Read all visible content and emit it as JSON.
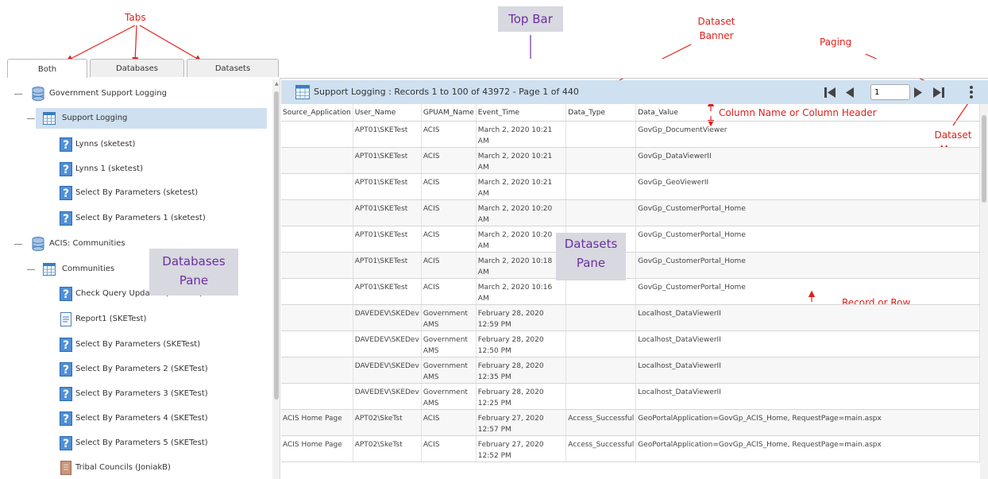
{
  "annotations": {
    "tabs": "Tabs",
    "top_bar": "Top Bar",
    "dataset_banner": "Dataset\nBanner",
    "paging": "Paging",
    "column_header": "Column Name or Column Header",
    "dataset_menu": "Dataset\nMenu",
    "record_row": "Record or Row",
    "databases_pane": "Databases\nPane",
    "datasets_pane": "Datasets\nPane"
  },
  "tabs": [
    "Both",
    "Databases",
    "Datasets"
  ],
  "tree": [
    {
      "label": "Government Support Logging",
      "icon": "database-icon"
    },
    {
      "label": "Support Logging",
      "icon": "table-icon"
    },
    {
      "label": "Lynns (sketest)",
      "icon": "query-icon"
    },
    {
      "label": "Lynns 1 (sketest)",
      "icon": "query-icon"
    },
    {
      "label": "Select By Parameters (sketest)",
      "icon": "query-icon"
    },
    {
      "label": "Select By Parameters 1 (sketest)",
      "icon": "query-icon"
    },
    {
      "label": "ACIS: Communities",
      "icon": "database-icon"
    },
    {
      "label": "Communities",
      "icon": "table-icon"
    },
    {
      "label": "Check Query Updated (SKETest)",
      "icon": "query-icon"
    },
    {
      "label": "Report1 (SKETest)",
      "icon": "report-icon"
    },
    {
      "label": "Select By Parameters (SKETest)",
      "icon": "query-icon"
    },
    {
      "label": "Select By Parameters 2 (SKETest)",
      "icon": "query-icon"
    },
    {
      "label": "Select By Parameters 3 (SKETest)",
      "icon": "query-icon"
    },
    {
      "label": "Select By Parameters 4 (SKETest)",
      "icon": "query-icon"
    },
    {
      "label": "Select By Parameters 5 (SKETest)",
      "icon": "query-icon"
    },
    {
      "label": "Tribal Councils (JoniakB)",
      "icon": "book-icon"
    }
  ],
  "banner": {
    "title": "Support Logging : Records 1 to 100 of 43972 - Page 1 of 440",
    "page_value": "1"
  },
  "columns": [
    "Source_Application",
    "User_Name",
    "GPUAM_Name",
    "Event_Time",
    "Data_Type",
    "Data_Value"
  ],
  "rows": [
    [
      "",
      "APT01\\SKETest",
      "ACIS",
      "March 2, 2020 10:21 AM",
      "",
      "GovGp_DocumentViewer"
    ],
    [
      "",
      "APT01\\SKETest",
      "ACIS",
      "March 2, 2020 10:21 AM",
      "",
      "GovGp_DataViewerII"
    ],
    [
      "",
      "APT01\\SKETest",
      "ACIS",
      "March 2, 2020 10:21 AM",
      "",
      "GovGp_GeoViewerII"
    ],
    [
      "",
      "APT01\\SKETest",
      "ACIS",
      "March 2, 2020 10:20 AM",
      "",
      "GovGp_CustomerPortal_Home"
    ],
    [
      "",
      "APT01\\SKETest",
      "ACIS",
      "March 2, 2020 10:20 AM",
      "",
      "GovGp_CustomerPortal_Home"
    ],
    [
      "",
      "APT01\\SKETest",
      "ACIS",
      "March 2, 2020 10:18 AM",
      "",
      "GovGp_CustomerPortal_Home"
    ],
    [
      "",
      "APT01\\SKETest",
      "ACIS",
      "March 2, 2020 10:16 AM",
      "",
      "GovGp_CustomerPortal_Home"
    ],
    [
      "",
      "DAVEDEV\\SKEDev",
      "Government AMS",
      "February 28, 2020 12:59 PM",
      "",
      "Localhost_DataViewerII"
    ],
    [
      "",
      "DAVEDEV\\SKEDev",
      "Government AMS",
      "February 28, 2020 12:50 PM",
      "",
      "Localhost_DataViewerII"
    ],
    [
      "",
      "DAVEDEV\\SKEDev",
      "Government AMS",
      "February 28, 2020 12:35 PM",
      "",
      "Localhost_DataViewerII"
    ],
    [
      "",
      "DAVEDEV\\SKEDev",
      "Government AMS",
      "February 28, 2020 12:25 PM",
      "",
      "Localhost_DataViewerII"
    ],
    [
      "ACIS Home Page",
      "APT02\\SkeTst",
      "ACIS",
      "February 27, 2020 12:57 PM",
      "Access_Successful",
      "GeoPortalApplication=GovGp_ACIS_Home, RequestPage=main.aspx"
    ],
    [
      "ACIS Home Page",
      "APT02\\SkeTst",
      "ACIS",
      "February 27, 2020 12:52 PM",
      "Access_Successful",
      "GeoPortalApplication=GovGp_ACIS_Home, RequestPage=main.aspx"
    ]
  ],
  "colors": {
    "selection": "#cfe0f1",
    "annotation": "#e0201b",
    "label_box_text": "#6b2fa0"
  }
}
